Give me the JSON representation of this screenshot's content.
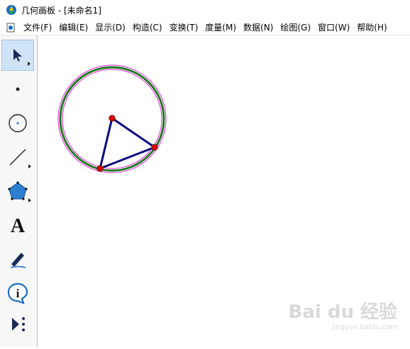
{
  "window": {
    "title": "几何画板 - [未命名1]"
  },
  "menu": {
    "items": [
      "文件(F)",
      "编辑(E)",
      "显示(D)",
      "构造(C)",
      "变换(T)",
      "度量(M)",
      "数据(N)",
      "绘图(G)",
      "窗口(W)",
      "帮助(H)"
    ]
  },
  "toolbox": {
    "tools": [
      {
        "name": "arrow-tool-icon",
        "selected": true
      },
      {
        "name": "point-tool-icon"
      },
      {
        "name": "compass-tool-icon"
      },
      {
        "name": "straightedge-tool-icon"
      },
      {
        "name": "polygon-tool-icon"
      },
      {
        "name": "text-tool-icon",
        "glyph": "A"
      },
      {
        "name": "marker-tool-icon"
      },
      {
        "name": "information-tool-icon",
        "glyph": "i"
      },
      {
        "name": "custom-tool-icon"
      }
    ]
  },
  "colors": {
    "circle_outer": "#e020e0",
    "circle_main": "#1e7a1e",
    "triangle": "#0a0a80",
    "point_fill": "#e00000",
    "selection": "#cfe3f7"
  },
  "watermark": {
    "logo": "Bai du 经验",
    "sub": "jingyan.baidu.com"
  }
}
